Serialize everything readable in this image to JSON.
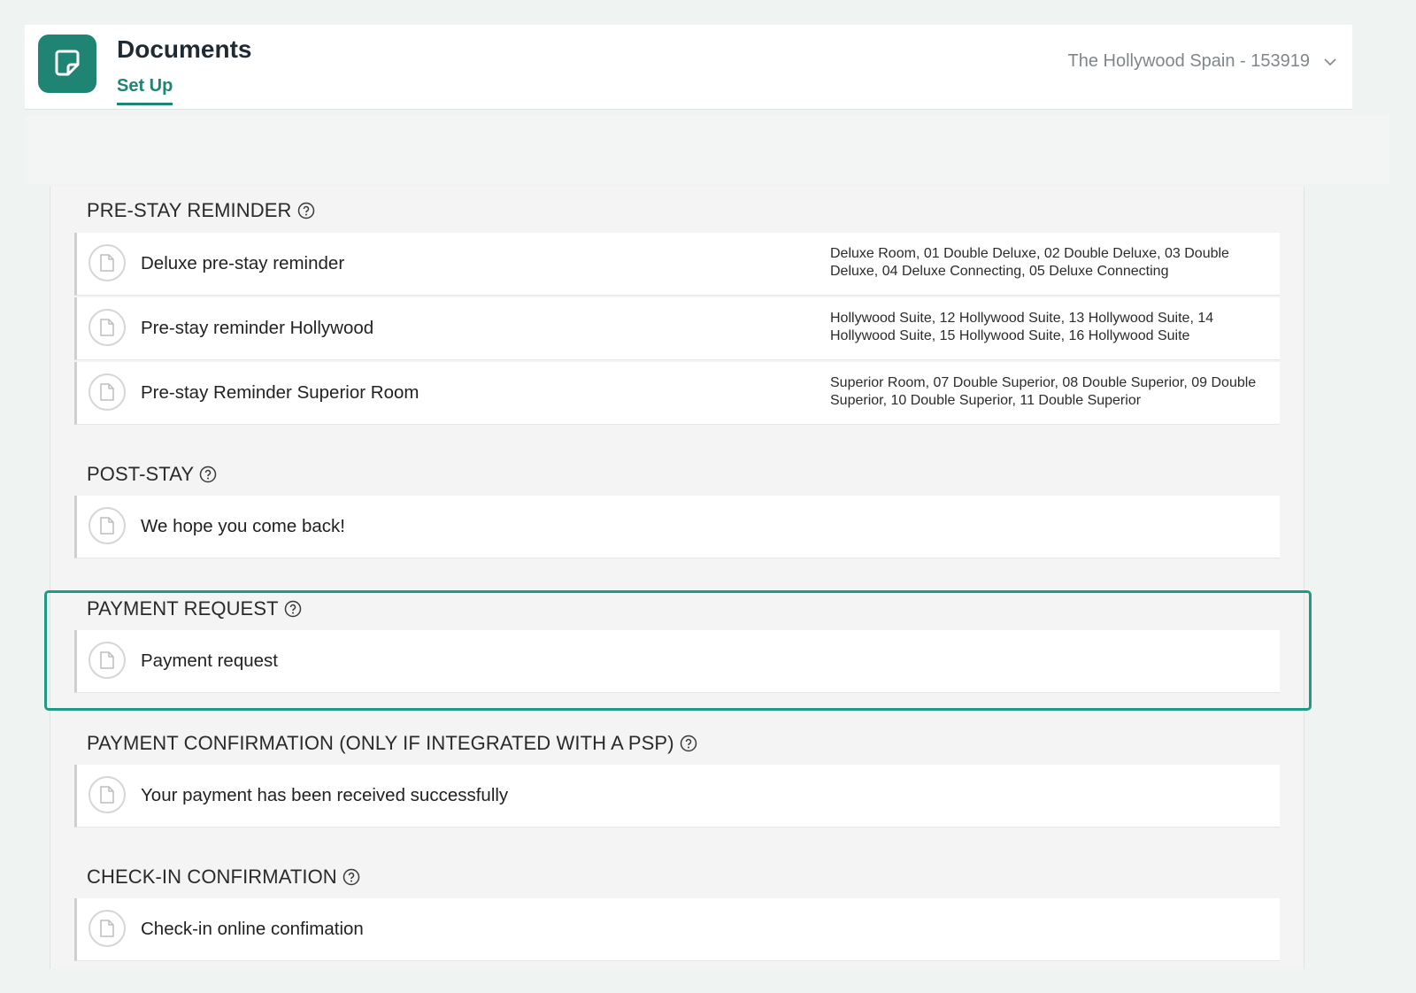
{
  "header": {
    "app_title": "Documents",
    "tab_label": "Set Up",
    "hotel_selector": "The Hollywood Spain - 153919",
    "brand_color": "#1f8474",
    "app_icon": "document-icon"
  },
  "sections": [
    {
      "title": "PRE-STAY REMINDER",
      "items": [
        {
          "name": "Deluxe pre-stay reminder",
          "rooms": "Deluxe Room, 01 Double Deluxe, 02 Double Deluxe, 03 Double Deluxe, 04 Deluxe Connecting, 05 Deluxe Connecting"
        },
        {
          "name": "Pre-stay reminder Hollywood",
          "rooms": "Hollywood Suite, 12 Hollywood Suite, 13 Hollywood Suite, 14 Hollywood Suite, 15 Hollywood Suite, 16 Hollywood Suite"
        },
        {
          "name": "Pre-stay Reminder Superior Room",
          "rooms": "Superior Room, 07 Double Superior, 08 Double Superior, 09 Double Superior, 10 Double Superior, 11 Double Superior"
        }
      ]
    },
    {
      "title": "POST-STAY",
      "items": [
        {
          "name": "We hope you come back!",
          "rooms": ""
        }
      ]
    },
    {
      "title": "PAYMENT REQUEST",
      "items": [
        {
          "name": "Payment request",
          "rooms": ""
        }
      ]
    },
    {
      "title": "PAYMENT CONFIRMATION (ONLY IF INTEGRATED WITH A PSP)",
      "items": [
        {
          "name": "Your payment has been received successfully",
          "rooms": ""
        }
      ]
    },
    {
      "title": "CHECK-IN CONFIRMATION",
      "items": [
        {
          "name": "Check-in online confimation",
          "rooms": ""
        }
      ]
    }
  ],
  "highlight_color": "#1f9a86"
}
